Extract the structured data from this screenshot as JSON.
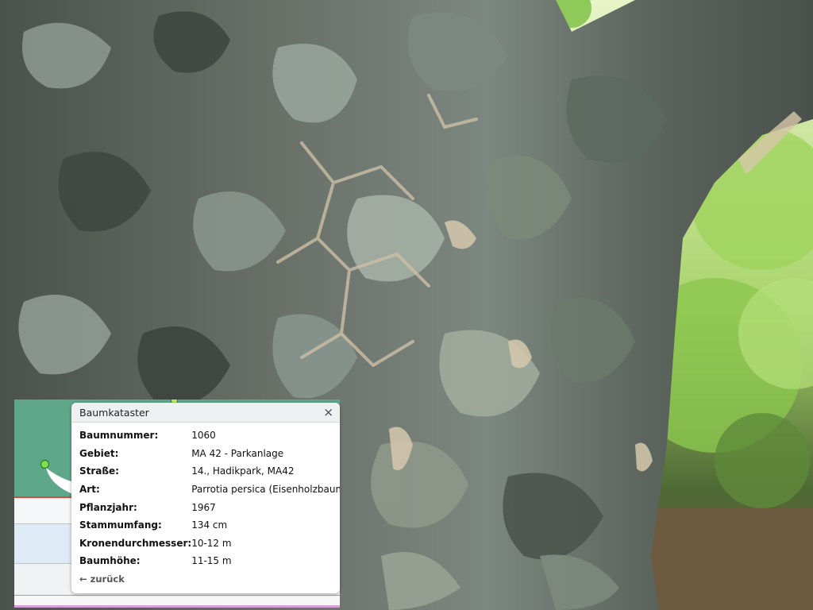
{
  "popup": {
    "title": "Baumkataster",
    "close_glyph": "×",
    "back_label": "← zurück",
    "rows": [
      {
        "label": "Baumnummer:",
        "value": "1060"
      },
      {
        "label": "Gebiet:",
        "value": "MA 42 - Parkanlage"
      },
      {
        "label": "Straße:",
        "value": "14., Hadikpark, MA42"
      },
      {
        "label": "Art:",
        "value": "Parrotia persica (Eisenholzbaum)"
      },
      {
        "label": "Pflanzjahr:",
        "value": "1967"
      },
      {
        "label": "Stammumfang:",
        "value": "134 cm"
      },
      {
        "label": "Kronendurchmesser:",
        "value": "10-12 m"
      },
      {
        "label": "Baumhöhe:",
        "value": "11-15 m"
      }
    ]
  },
  "colors": {
    "bark_dark": "#3f4440",
    "bark_mid": "#6f7b73",
    "bark_light": "#b5bdb0",
    "bark_tan": "#c9bba0",
    "foliage": "#8fc95a",
    "map_green": "#5fa78b",
    "marker": "#7fe04a"
  }
}
